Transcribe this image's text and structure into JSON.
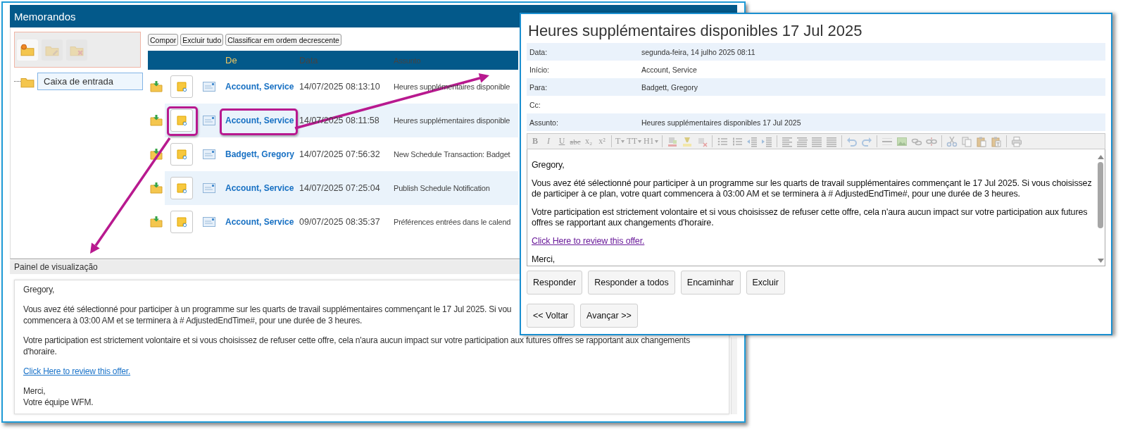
{
  "main_window": {
    "title": "Memorandos",
    "folder_toolbar": [
      {
        "kind": "new",
        "disabled": false
      },
      {
        "kind": "rename",
        "disabled": true
      },
      {
        "kind": "delete",
        "disabled": true
      }
    ],
    "folders": [
      {
        "label": "Caixa de entrada",
        "selected": true
      }
    ],
    "actions": [
      "Compor",
      "Excluir tudo",
      "Classificar em ordem decrescente"
    ],
    "message_list": {
      "columns": [
        "De",
        "Data",
        "Assunto"
      ],
      "rows": [
        {
          "from": "Account, Service",
          "date": "14/07/2025 08:13:10",
          "subject": "Heures supplémentaires disponible",
          "highlighted": false
        },
        {
          "from": "Account, Service",
          "date": "14/07/2025 08:11:58",
          "subject": "Heures supplémentaires disponible",
          "highlighted": true
        },
        {
          "from": "Badgett, Gregory",
          "date": "14/07/2025 07:56:32",
          "subject": "New Schedule Transaction: Badget",
          "highlighted": false
        },
        {
          "from": "Account, Service",
          "date": "14/07/2025 07:25:04",
          "subject": "Publish Schedule Notification",
          "highlighted": false
        },
        {
          "from": "Account, Service",
          "date": "09/07/2025 08:35:37",
          "subject": "Préférences entrées dans le calend",
          "highlighted": false
        }
      ]
    },
    "preview": {
      "title": "Painel de visualização",
      "paragraphs": [
        {
          "kind": "text",
          "lines": [
            "Gregory,"
          ]
        },
        {
          "kind": "text",
          "lines": [
            "Vous avez été sélectionné pour participer à un programme sur les quarts de travail supplémentaires commençant le 17 Jul 2025. Si vou",
            "commencera à 03:00 AM et se terminera à # AdjustedEndTime#, pour une durée de 3 heures."
          ]
        },
        {
          "kind": "text",
          "lines": [
            "Votre participation est strictement volontaire et si vous choisissez de refuser cette offre, cela n'aura aucun impact sur votre participation aux futures offres se rapportant aux changements",
            "d'horaire."
          ]
        },
        {
          "kind": "link",
          "lines": [
            "Click Here to review this offer."
          ]
        },
        {
          "kind": "text",
          "lines": [
            "Merci,",
            "Votre équipe WFM."
          ]
        }
      ]
    }
  },
  "message_window": {
    "title": "Heures supplémentaires disponibles 17 Jul 2025",
    "fields": [
      {
        "label": "Data:",
        "value": "segunda-feira, 14 julho 2025 08:11"
      },
      {
        "label": "Início:",
        "value": "Account, Service"
      },
      {
        "label": "Para:",
        "value": "Badgett, Gregory"
      },
      {
        "label": "Cc:"
      },
      {
        "label": "Assunto:",
        "value": "Heures supplémentaires disponibles 17 Jul 2025"
      }
    ],
    "editor_toolbar": {
      "disabled": true,
      "items": [
        {
          "kind": "glyph",
          "label": "B"
        },
        {
          "kind": "glyph",
          "label": "I"
        },
        {
          "kind": "glyph",
          "label": "U"
        },
        {
          "kind": "glyph",
          "label": "abc"
        },
        {
          "kind": "glyph",
          "label": "x₂"
        },
        {
          "kind": "glyph",
          "label": "x²"
        },
        {
          "kind": "separator"
        },
        {
          "kind": "dropdown",
          "label": "T"
        },
        {
          "kind": "dropdown",
          "label": "TT"
        },
        {
          "kind": "dropdown",
          "label": "H1"
        },
        {
          "kind": "separator"
        },
        {
          "kind": "icon"
        },
        {
          "kind": "icon"
        },
        {
          "kind": "icon"
        },
        {
          "kind": "separator"
        },
        {
          "kind": "icon"
        },
        {
          "kind": "icon"
        },
        {
          "kind": "icon"
        },
        {
          "kind": "icon"
        },
        {
          "kind": "separator"
        },
        {
          "kind": "icon"
        },
        {
          "kind": "icon"
        },
        {
          "kind": "icon"
        },
        {
          "kind": "icon"
        },
        {
          "kind": "separator"
        },
        {
          "kind": "icon"
        },
        {
          "kind": "icon"
        },
        {
          "kind": "separator"
        },
        {
          "kind": "icon"
        },
        {
          "kind": "icon"
        },
        {
          "kind": "icon"
        },
        {
          "kind": "icon"
        },
        {
          "kind": "separator"
        },
        {
          "kind": "icon"
        },
        {
          "kind": "icon"
        },
        {
          "kind": "icon"
        },
        {
          "kind": "icon"
        },
        {
          "kind": "separator"
        },
        {
          "kind": "icon"
        }
      ]
    },
    "body": [
      {
        "kind": "text",
        "text": "Gregory,"
      },
      {
        "kind": "text",
        "text": "Vous avez été sélectionné pour participer à un programme sur les quarts de travail supplémentaires commençant le 17 Jul 2025. Si vous choisissez de participer à ce plan, votre quart commencera à 03:00 AM et se terminera à # AdjustedEndTime#, pour une durée de 3 heures."
      },
      {
        "kind": "text",
        "text": "Votre participation est strictement volontaire et si vous choisissez de refuser cette offre, cela n'aura aucun impact sur votre participation aux futures offres se rapportant aux changements d'horaire."
      },
      {
        "kind": "link",
        "text": "Click Here to review this offer."
      },
      {
        "kind": "text",
        "text": "Merci,"
      }
    ],
    "actions": [
      "Responder",
      "Responder a todos",
      "Encaminhar",
      "Excluir"
    ],
    "navigation": [
      "<< Voltar",
      "Avançar >>"
    ]
  }
}
